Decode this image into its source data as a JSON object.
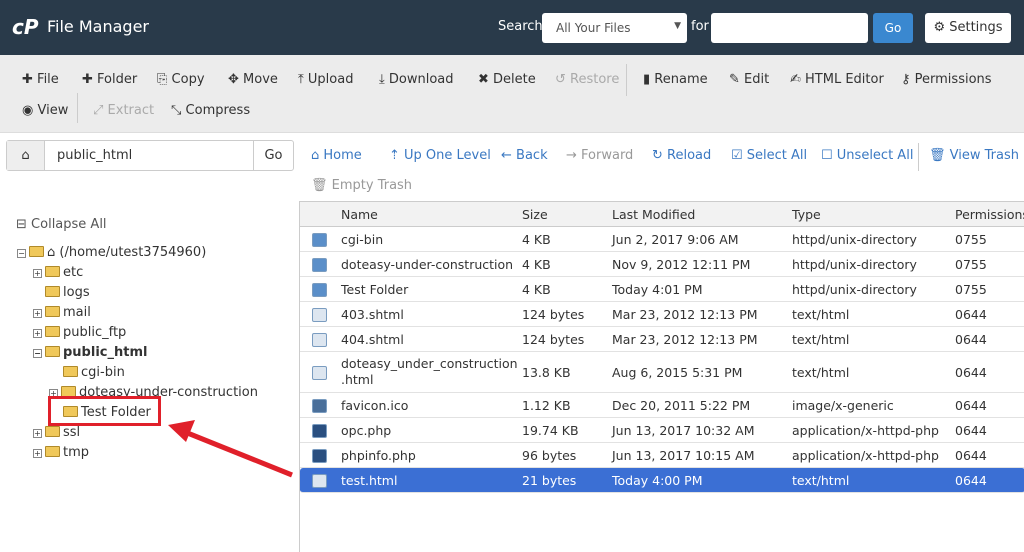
{
  "header": {
    "logo": "cP",
    "title": "File Manager",
    "search_label": "Search",
    "search_scope": "All Your Files",
    "for_label": "for",
    "search_value": "",
    "go": "Go",
    "settings": "Settings"
  },
  "toolbar": [
    {
      "label": "File",
      "icon": "plus-icon",
      "glyph": "✚",
      "enabled": true
    },
    {
      "label": "Folder",
      "icon": "plus-icon",
      "glyph": "✚",
      "enabled": true
    },
    {
      "label": "Copy",
      "icon": "copy-icon",
      "glyph": "⎘",
      "enabled": true
    },
    {
      "label": "Move",
      "icon": "move-icon",
      "glyph": "✥",
      "enabled": true
    },
    {
      "label": "Upload",
      "icon": "upload-icon",
      "glyph": "⤒",
      "enabled": true
    },
    {
      "label": "Download",
      "icon": "download-icon",
      "glyph": "⤓",
      "enabled": true
    },
    {
      "label": "Delete",
      "icon": "delete-icon",
      "glyph": "✖",
      "enabled": true
    },
    {
      "label": "Restore",
      "icon": "restore-icon",
      "glyph": "↺",
      "enabled": false
    },
    {
      "label": "Rename",
      "icon": "file-icon",
      "glyph": "▮",
      "enabled": true
    },
    {
      "label": "Edit",
      "icon": "pencil-icon",
      "glyph": "✎",
      "enabled": true
    },
    {
      "label": "HTML Editor",
      "icon": "edit-icon",
      "glyph": "✍",
      "enabled": true
    },
    {
      "label": "Permissions",
      "icon": "key-icon",
      "glyph": "⚷",
      "enabled": true
    },
    {
      "label": "View",
      "icon": "eye-icon",
      "glyph": "◉",
      "enabled": true
    },
    {
      "label": "Extract",
      "icon": "expand-icon",
      "glyph": "⤢",
      "enabled": false
    },
    {
      "label": "Compress",
      "icon": "compress-icon",
      "glyph": "⤡",
      "enabled": true
    }
  ],
  "path": {
    "value": "public_html",
    "go": "Go"
  },
  "nav": [
    {
      "label": "Home",
      "glyph": "⌂",
      "enabled": true
    },
    {
      "label": "Up One Level",
      "glyph": "⇡",
      "enabled": true
    },
    {
      "label": "Back",
      "glyph": "←",
      "enabled": true
    },
    {
      "label": "Forward",
      "glyph": "→",
      "enabled": false
    },
    {
      "label": "Reload",
      "glyph": "↻",
      "enabled": true
    },
    {
      "label": "Select All",
      "glyph": "☑",
      "enabled": true
    },
    {
      "label": "Unselect All",
      "glyph": "☐",
      "enabled": true
    },
    {
      "label": "View Trash",
      "glyph": "🗑",
      "enabled": true
    },
    {
      "label": "Empty Trash",
      "glyph": "🗑",
      "enabled": false
    }
  ],
  "tree": {
    "collapse_all": "Collapse All",
    "root": "(/home/utest3754960)",
    "items": [
      {
        "label": "etc",
        "expandable": true,
        "level": 1
      },
      {
        "label": "logs",
        "expandable": false,
        "level": 1
      },
      {
        "label": "mail",
        "expandable": true,
        "level": 1
      },
      {
        "label": "public_ftp",
        "expandable": true,
        "level": 1
      },
      {
        "label": "public_html",
        "expandable": true,
        "level": 1,
        "open": true
      },
      {
        "label": "cgi-bin",
        "expandable": false,
        "level": 2
      },
      {
        "label": "doteasy-under-construction",
        "expandable": true,
        "level": 2
      },
      {
        "label": "Test Folder",
        "expandable": false,
        "level": 2
      },
      {
        "label": "ssl",
        "expandable": true,
        "level": 1
      },
      {
        "label": "tmp",
        "expandable": true,
        "level": 1
      }
    ]
  },
  "table": {
    "columns": [
      "Name",
      "Size",
      "Last Modified",
      "Type",
      "Permissions"
    ],
    "rows": [
      {
        "kind": "folder",
        "name": "cgi-bin",
        "size": "4 KB",
        "modified": "Jun 2, 2017 9:06 AM",
        "type": "httpd/unix-directory",
        "perms": "0755"
      },
      {
        "kind": "folder",
        "name": "doteasy-under-construction",
        "size": "4 KB",
        "modified": "Nov 9, 2012 12:11 PM",
        "type": "httpd/unix-directory",
        "perms": "0755"
      },
      {
        "kind": "folder",
        "name": "Test Folder",
        "size": "4 KB",
        "modified": "Today 4:01 PM",
        "type": "httpd/unix-directory",
        "perms": "0755"
      },
      {
        "kind": "html",
        "name": "403.shtml",
        "size": "124 bytes",
        "modified": "Mar 23, 2012 12:13 PM",
        "type": "text/html",
        "perms": "0644"
      },
      {
        "kind": "html",
        "name": "404.shtml",
        "size": "124 bytes",
        "modified": "Mar 23, 2012 12:13 PM",
        "type": "text/html",
        "perms": "0644"
      },
      {
        "kind": "html",
        "name": "doteasy_under_construction\n.html",
        "size": "13.8 KB",
        "modified": "Aug 6, 2015 5:31 PM",
        "type": "text/html",
        "perms": "0644"
      },
      {
        "kind": "image",
        "name": "favicon.ico",
        "size": "1.12 KB",
        "modified": "Dec 20, 2011 5:22 PM",
        "type": "image/x-generic",
        "perms": "0644"
      },
      {
        "kind": "php",
        "name": "opc.php",
        "size": "19.74 KB",
        "modified": "Jun 13, 2017 10:32 AM",
        "type": "application/x-httpd-php",
        "perms": "0644"
      },
      {
        "kind": "php",
        "name": "phpinfo.php",
        "size": "96 bytes",
        "modified": "Jun 13, 2017 10:15 AM",
        "type": "application/x-httpd-php",
        "perms": "0644"
      },
      {
        "kind": "html",
        "name": "test.html",
        "size": "21 bytes",
        "modified": "Today 4:00 PM",
        "type": "text/html",
        "perms": "0644",
        "selected": true
      }
    ]
  },
  "colors": {
    "header": "#293a4a",
    "accent": "#3a88d0",
    "selected_row": "#3b6fd4",
    "annotation": "#e0202a"
  }
}
